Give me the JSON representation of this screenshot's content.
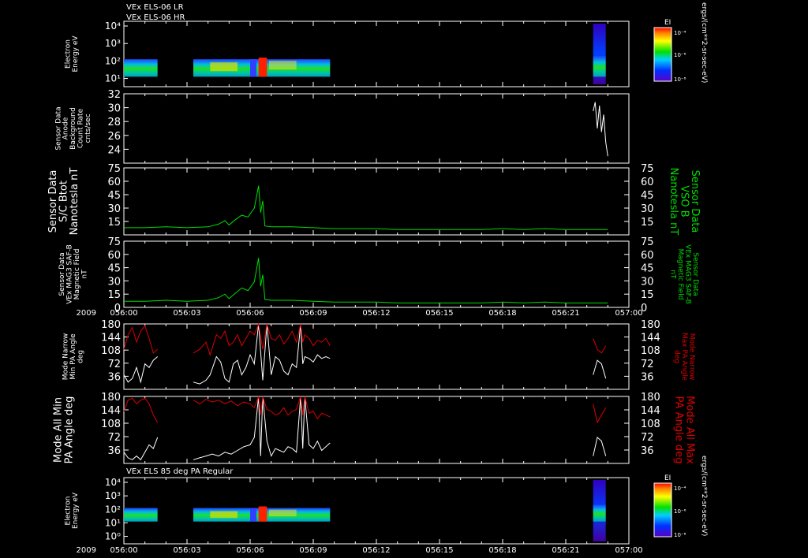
{
  "header": {
    "line1": "VEx ELS-06 LR",
    "line2": "VEx ELS-06 HR"
  },
  "bottom_title": "VEx ELS 85 deg PA Regular",
  "year": "2009",
  "x_ticks": [
    "056:00",
    "056:03",
    "056:06",
    "056:09",
    "056:12",
    "056:15",
    "056:18",
    "056:21",
    "057:00"
  ],
  "x_ticks_mid": [
    "056:00",
    "056:03",
    "056:06",
    "056:09",
    "056:12",
    "056:15",
    "056:18",
    "056:21",
    "057:00"
  ],
  "colorbar": {
    "label": "EI",
    "ticks": [
      "10⁻⁴",
      "10⁻⁶",
      "10⁻⁸"
    ],
    "units": "ergs/(cm**2-sr-sec-eV)"
  },
  "colors": {
    "white": "#ffffff",
    "green": "#00dd00",
    "red": "#dd0000"
  },
  "chart_data": [
    {
      "type": "heatmap",
      "ylabel": "Electron Energy eV",
      "yticks": [
        "10⁴",
        "10³",
        "10²",
        "10¹"
      ],
      "ylog": true,
      "segments_minutes": [
        [
          0.0,
          1.6
        ],
        [
          3.3,
          9.8
        ],
        [
          22.3,
          22.9
        ]
      ]
    },
    {
      "type": "line",
      "ylabel": "Sensor Data Anode Background Count Rate cnts/sec",
      "ylim": [
        22,
        32
      ],
      "yticks": [
        24,
        26,
        28,
        30,
        32
      ],
      "series": [
        {
          "color": "#ffffff",
          "x": [
            22.3,
            22.4,
            22.5,
            22.6,
            22.7,
            22.8,
            22.9,
            23.0
          ],
          "y": [
            29.5,
            30.8,
            27.0,
            30.3,
            26.5,
            29.0,
            25.0,
            23.0
          ]
        }
      ]
    },
    {
      "type": "line",
      "ylabel": "Sensor Data S/C Btot Nanotesla nT",
      "ylabel_right": "Sensor Data VSO B Nanotesla nT",
      "ylim": [
        0,
        75
      ],
      "yticks": [
        15,
        30,
        45,
        60,
        75
      ],
      "series": [
        {
          "color": "#00dd00",
          "x": [
            0,
            1,
            2,
            3,
            4,
            4.5,
            4.8,
            5.0,
            5.3,
            5.6,
            5.9,
            6.2,
            6.4,
            6.5,
            6.6,
            6.7,
            7,
            8,
            9,
            10,
            11,
            12,
            13,
            14,
            15,
            16,
            17,
            18,
            19,
            20,
            21,
            22,
            23
          ],
          "y": [
            8,
            8,
            9,
            8,
            9,
            12,
            16,
            11,
            17,
            22,
            20,
            30,
            55,
            25,
            38,
            10,
            9,
            9,
            8,
            7,
            7,
            7,
            6,
            6,
            6,
            6,
            6,
            7,
            6,
            7,
            6,
            6,
            6
          ]
        }
      ]
    },
    {
      "type": "line",
      "ylabel": "Sensor Data VEx MAG3 SAF-B Magnetic Field nT",
      "ylabel_right": "Sensor Data VEx MAG3 SAF-B Magnetic Field nT",
      "ylim": [
        0,
        75
      ],
      "yticks": [
        0,
        15,
        30,
        45,
        60,
        75
      ],
      "series": [
        {
          "color": "#00dd00",
          "x": [
            0,
            1,
            2,
            3,
            4,
            4.5,
            4.8,
            5.0,
            5.3,
            5.6,
            5.9,
            6.2,
            6.4,
            6.5,
            6.6,
            6.7,
            7,
            8,
            9,
            10,
            11,
            12,
            13,
            14,
            15,
            16,
            17,
            18,
            19,
            20,
            21,
            22,
            23
          ],
          "y": [
            7,
            7,
            8,
            7,
            8,
            11,
            15,
            10,
            16,
            22,
            19,
            29,
            56,
            24,
            37,
            9,
            8,
            8,
            7,
            6,
            6,
            6,
            5,
            5,
            5,
            5,
            5,
            6,
            5,
            6,
            5,
            5,
            5
          ]
        }
      ]
    },
    {
      "type": "line",
      "ylabel": "Mode Narrow Min PA Angle deg",
      "ylabel_right": "Mode Narrow Max PA Angle deg",
      "ylim": [
        0,
        180
      ],
      "yticks": [
        36,
        72,
        108,
        144,
        180
      ],
      "series": [
        {
          "color": "#ffffff",
          "segments": [
            {
              "x": [
                0.0,
                0.2,
                0.4,
                0.6,
                0.8,
                1.0,
                1.2,
                1.4,
                1.6
              ],
              "y": [
                40,
                20,
                30,
                60,
                20,
                70,
                60,
                80,
                90
              ]
            },
            {
              "x": [
                3.3,
                3.6,
                3.9,
                4.1,
                4.4,
                4.6,
                4.8,
                5.0,
                5.2,
                5.4,
                5.6,
                5.8,
                6.0,
                6.2,
                6.4,
                6.6,
                6.8,
                7.0,
                7.2,
                7.4,
                7.6,
                7.8,
                8.0,
                8.2,
                8.4,
                8.5,
                8.6,
                8.8,
                9.0,
                9.2,
                9.4,
                9.6,
                9.8
              ],
              "y": [
                20,
                15,
                25,
                40,
                90,
                75,
                30,
                20,
                70,
                80,
                40,
                60,
                95,
                70,
                180,
                25,
                180,
                40,
                90,
                80,
                50,
                40,
                70,
                60,
                180,
                70,
                90,
                85,
                75,
                95,
                85,
                90,
                85
              ]
            },
            {
              "x": [
                22.3,
                22.5,
                22.7,
                22.9
              ],
              "y": [
                40,
                80,
                70,
                30
              ]
            }
          ]
        },
        {
          "color": "#dd0000",
          "segments": [
            {
              "x": [
                0.0,
                0.2,
                0.4,
                0.6,
                0.8,
                1.0,
                1.2,
                1.4,
                1.6
              ],
              "y": [
                110,
                150,
                170,
                130,
                160,
                175,
                140,
                100,
                110
              ]
            },
            {
              "x": [
                3.3,
                3.6,
                3.9,
                4.1,
                4.4,
                4.6,
                4.8,
                5.0,
                5.2,
                5.4,
                5.6,
                5.8,
                6.0,
                6.2,
                6.4,
                6.6,
                6.8,
                7.0,
                7.2,
                7.4,
                7.6,
                7.8,
                8.0,
                8.2,
                8.4,
                8.5,
                8.6,
                8.8,
                9.0,
                9.2,
                9.4,
                9.6,
                9.8
              ],
              "y": [
                100,
                110,
                130,
                95,
                150,
                140,
                160,
                120,
                130,
                150,
                120,
                140,
                160,
                150,
                180,
                110,
                180,
                140,
                135,
                150,
                125,
                140,
                160,
                130,
                180,
                130,
                150,
                140,
                120,
                135,
                130,
                140,
                120
              ]
            },
            {
              "x": [
                22.3,
                22.5,
                22.7,
                22.9
              ],
              "y": [
                140,
                110,
                100,
                120
              ]
            }
          ]
        }
      ]
    },
    {
      "type": "line",
      "ylabel": "Mode All Min PA Angle deg",
      "ylabel_right": "Mode All Max PA Angle deg",
      "ylim": [
        0,
        180
      ],
      "yticks": [
        36,
        72,
        108,
        144,
        180
      ],
      "series": [
        {
          "color": "#ffffff",
          "segments": [
            {
              "x": [
                0.0,
                0.2,
                0.4,
                0.6,
                0.8,
                1.0,
                1.2,
                1.4,
                1.6
              ],
              "y": [
                30,
                15,
                10,
                20,
                10,
                30,
                50,
                40,
                70
              ]
            },
            {
              "x": [
                3.3,
                3.6,
                3.9,
                4.2,
                4.5,
                4.8,
                5.1,
                5.4,
                5.7,
                6.0,
                6.2,
                6.4,
                6.5,
                6.6,
                6.8,
                7.0,
                7.2,
                7.4,
                7.6,
                7.8,
                8.0,
                8.2,
                8.4,
                8.5,
                8.6,
                8.8,
                9.0,
                9.2,
                9.4,
                9.6,
                9.8
              ],
              "y": [
                10,
                15,
                20,
                25,
                20,
                30,
                25,
                35,
                45,
                50,
                70,
                180,
                20,
                180,
                60,
                20,
                40,
                35,
                30,
                45,
                40,
                30,
                180,
                40,
                180,
                50,
                40,
                60,
                35,
                45,
                55
              ]
            },
            {
              "x": [
                22.3,
                22.5,
                22.7,
                22.9
              ],
              "y": [
                20,
                70,
                60,
                20
              ]
            }
          ]
        },
        {
          "color": "#dd0000",
          "segments": [
            {
              "x": [
                0.0,
                0.2,
                0.4,
                0.6,
                0.8,
                1.0,
                1.2,
                1.4,
                1.6
              ],
              "y": [
                140,
                170,
                175,
                160,
                170,
                175,
                160,
                130,
                110
              ]
            },
            {
              "x": [
                3.3,
                3.6,
                3.9,
                4.2,
                4.5,
                4.8,
                5.1,
                5.4,
                5.7,
                6.0,
                6.2,
                6.4,
                6.5,
                6.6,
                6.8,
                7.0,
                7.2,
                7.4,
                7.6,
                7.8,
                8.0,
                8.2,
                8.4,
                8.5,
                8.6,
                8.8,
                9.0,
                9.2,
                9.4,
                9.6,
                9.8
              ],
              "y": [
                170,
                160,
                172,
                165,
                170,
                160,
                168,
                155,
                165,
                160,
                150,
                180,
                130,
                180,
                145,
                140,
                130,
                135,
                150,
                130,
                140,
                145,
                180,
                130,
                180,
                135,
                140,
                120,
                135,
                130,
                125
              ]
            },
            {
              "x": [
                22.3,
                22.5,
                22.7,
                22.9
              ],
              "y": [
                160,
                110,
                130,
                150
              ]
            }
          ]
        }
      ]
    },
    {
      "type": "heatmap",
      "ylabel": "Electron Energy eV",
      "yticks": [
        "10⁴",
        "10³",
        "10²",
        "10¹",
        "10⁰"
      ],
      "ylog": true,
      "segments_minutes": [
        [
          0.0,
          1.6
        ],
        [
          3.3,
          9.8
        ],
        [
          22.3,
          22.9
        ]
      ]
    }
  ]
}
